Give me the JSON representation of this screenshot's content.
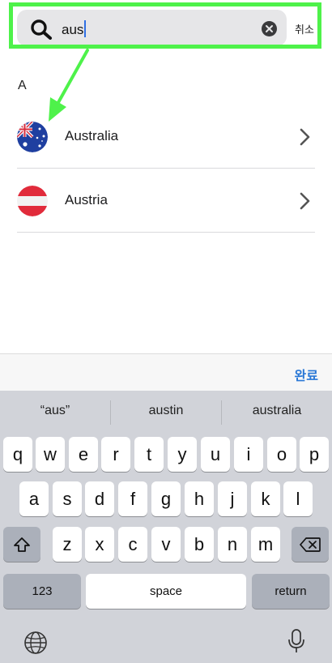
{
  "search": {
    "value": "aus",
    "cancel_label": "취소"
  },
  "section_header": "A",
  "results": [
    {
      "name": "Australia",
      "flag": "flag-australia-icon"
    },
    {
      "name": "Austria",
      "flag": "flag-austria-icon"
    }
  ],
  "toolbar": {
    "done_label": "완료"
  },
  "keyboard": {
    "suggestions": [
      "“aus”",
      "austin",
      "australia"
    ],
    "row1": [
      "q",
      "w",
      "e",
      "r",
      "t",
      "y",
      "u",
      "i",
      "o",
      "p"
    ],
    "row2": [
      "a",
      "s",
      "d",
      "f",
      "g",
      "h",
      "j",
      "k",
      "l"
    ],
    "row3": [
      "z",
      "x",
      "c",
      "v",
      "b",
      "n",
      "m"
    ],
    "numbers_label": "123",
    "space_label": "space",
    "return_label": "return"
  },
  "colors": {
    "highlight": "#4ef24a",
    "accent": "#2a78d6"
  }
}
